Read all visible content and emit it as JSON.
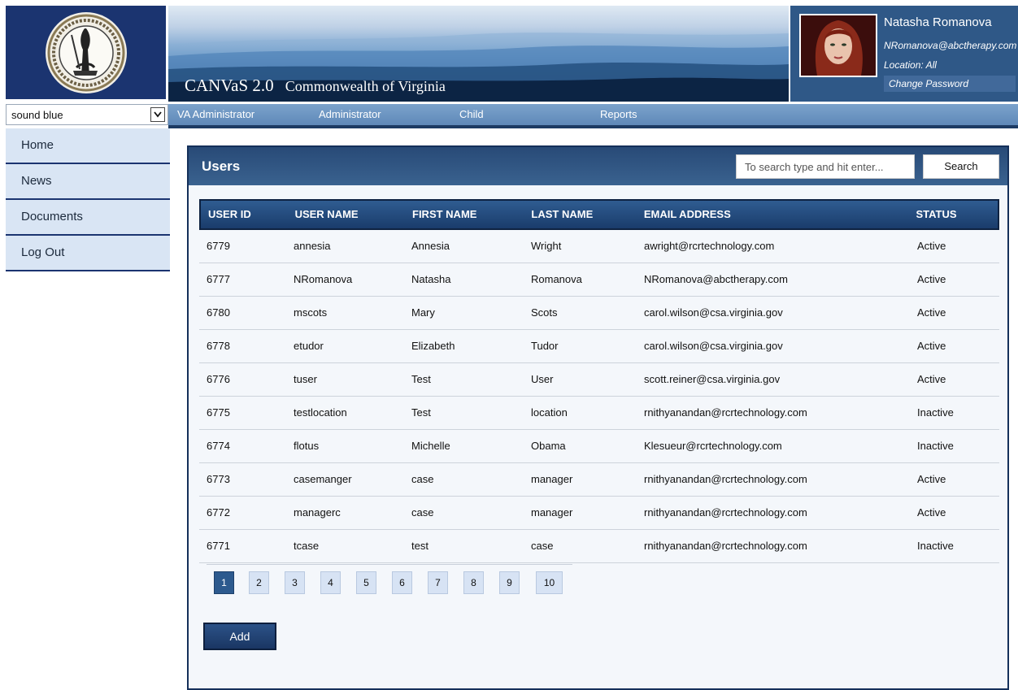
{
  "header": {
    "app_name": "CANVaS 2.0",
    "org_name": "Commonwealth of Virginia",
    "logo_icon": "virginia-state-seal"
  },
  "profile": {
    "name": "Natasha Romanova",
    "email": "NRomanova@abctherapy.com",
    "location": "Location: All",
    "change_password": "Change Password"
  },
  "location_select": {
    "value": "sound blue"
  },
  "nav": {
    "items": [
      "VA Administrator",
      "Administrator",
      "Child",
      "Reports"
    ]
  },
  "sidebar": {
    "items": [
      "Home",
      "News",
      "Documents",
      "Log Out"
    ]
  },
  "users": {
    "title": "Users",
    "search_placeholder": "To search type and hit enter...",
    "search_button": "Search",
    "columns": [
      "USER ID",
      "USER NAME",
      "FIRST NAME",
      "LAST NAME",
      "EMAIL ADDRESS",
      "STATUS"
    ],
    "rows": [
      [
        "6779",
        "annesia",
        "Annesia",
        "Wright",
        "awright@rcrtechnology.com",
        "Active"
      ],
      [
        "6777",
        "NRomanova",
        "Natasha",
        "Romanova",
        "NRomanova@abctherapy.com",
        "Active"
      ],
      [
        "6780",
        "mscots",
        "Mary",
        "Scots",
        "carol.wilson@csa.virginia.gov",
        "Active"
      ],
      [
        "6778",
        "etudor",
        "Elizabeth",
        "Tudor",
        "carol.wilson@csa.virginia.gov",
        "Active"
      ],
      [
        "6776",
        "tuser",
        "Test",
        "User",
        "scott.reiner@csa.virginia.gov",
        "Active"
      ],
      [
        "6775",
        "testlocation",
        "Test",
        "location",
        "rnithyanandan@rcrtechnology.com",
        "Inactive"
      ],
      [
        "6774",
        "flotus",
        "Michelle",
        "Obama",
        "Klesueur@rcrtechnology.com",
        "Inactive"
      ],
      [
        "6773",
        "casemanger",
        "case",
        "manager",
        "rnithyanandan@rcrtechnology.com",
        "Active"
      ],
      [
        "6772",
        "managerc",
        "case",
        "manager",
        "rnithyanandan@rcrtechnology.com",
        "Active"
      ],
      [
        "6771",
        "tcase",
        "test",
        "case",
        "rnithyanandan@rcrtechnology.com",
        "Inactive"
      ]
    ],
    "pages": [
      "1",
      "2",
      "3",
      "4",
      "5",
      "6",
      "7",
      "8",
      "9",
      "10"
    ],
    "current_page": "1",
    "add_button": "Add"
  },
  "colors": {
    "navy": "#1b3470",
    "header_blue": "#2f5887",
    "nav_blue": "#6a93c2",
    "sidebar_bg": "#d9e5f4",
    "active_page": "#2d5a8e"
  }
}
